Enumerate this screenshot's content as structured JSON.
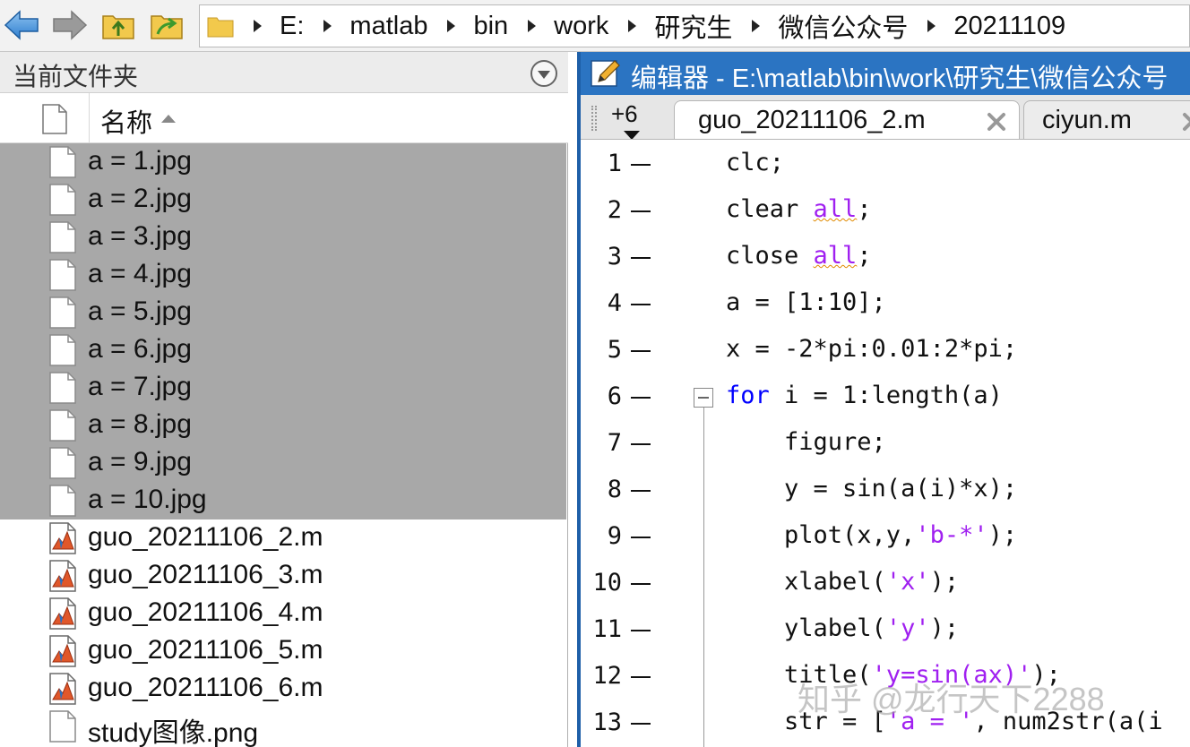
{
  "toolbar": {
    "back_icon": "arrow-left-icon",
    "forward_icon": "arrow-right-icon",
    "up_icon": "folder-up-icon",
    "browse_icon": "browse-folder-icon",
    "address": [
      "E:",
      "matlab",
      "bin",
      "work",
      "研究生",
      "微信公众号",
      "20211109"
    ]
  },
  "folder_panel": {
    "title": "当前文件夹",
    "column_name": "名称",
    "files": [
      {
        "name": "a = 1.jpg",
        "type": "image",
        "selected": true
      },
      {
        "name": "a = 2.jpg",
        "type": "image",
        "selected": true
      },
      {
        "name": "a = 3.jpg",
        "type": "image",
        "selected": true
      },
      {
        "name": "a = 4.jpg",
        "type": "image",
        "selected": true
      },
      {
        "name": "a = 5.jpg",
        "type": "image",
        "selected": true
      },
      {
        "name": "a = 6.jpg",
        "type": "image",
        "selected": true
      },
      {
        "name": "a = 7.jpg",
        "type": "image",
        "selected": true
      },
      {
        "name": "a = 8.jpg",
        "type": "image",
        "selected": true
      },
      {
        "name": "a = 9.jpg",
        "type": "image",
        "selected": true
      },
      {
        "name": "a = 10.jpg",
        "type": "image",
        "selected": true
      },
      {
        "name": "guo_20211106_2.m",
        "type": "matlab",
        "selected": false
      },
      {
        "name": "guo_20211106_3.m",
        "type": "matlab",
        "selected": false
      },
      {
        "name": "guo_20211106_4.m",
        "type": "matlab",
        "selected": false
      },
      {
        "name": "guo_20211106_5.m",
        "type": "matlab",
        "selected": false
      },
      {
        "name": "guo_20211106_6.m",
        "type": "matlab",
        "selected": false
      },
      {
        "name": "study图像.png",
        "type": "image",
        "selected": false
      }
    ]
  },
  "editor": {
    "title": "编辑器 - E:\\matlab\\bin\\work\\研究生\\微信公众号",
    "tab_count": "+6",
    "tabs": [
      {
        "label": "guo_20211106_2.m",
        "active": true
      },
      {
        "label": "ciyun.m",
        "active": false
      }
    ],
    "lines": [
      {
        "num": "1",
        "code": "clc;"
      },
      {
        "num": "2",
        "code": "clear all;"
      },
      {
        "num": "3",
        "code": "close all;"
      },
      {
        "num": "4",
        "code": "a = [1:10];"
      },
      {
        "num": "5",
        "code": "x = -2*pi:0.01:2*pi;"
      },
      {
        "num": "6",
        "code": "for i = 1:length(a)"
      },
      {
        "num": "7",
        "code": "    figure;"
      },
      {
        "num": "8",
        "code": "    y = sin(a(i)*x);"
      },
      {
        "num": "9",
        "code": "    plot(x,y,'b-*');"
      },
      {
        "num": "10",
        "code": "    xlabel('x');"
      },
      {
        "num": "11",
        "code": "    ylabel('y');"
      },
      {
        "num": "12",
        "code": "    title('y=sin(ax)');"
      },
      {
        "num": "13",
        "code": "    str = ['a = ', num2str(a(i"
      }
    ]
  },
  "watermark": "知乎 @龙行天下2288",
  "colors": {
    "selection": "#a8a8a8",
    "editor_title": "#2b74c2",
    "keyword": "#0000ff",
    "string": "#a020f0"
  }
}
